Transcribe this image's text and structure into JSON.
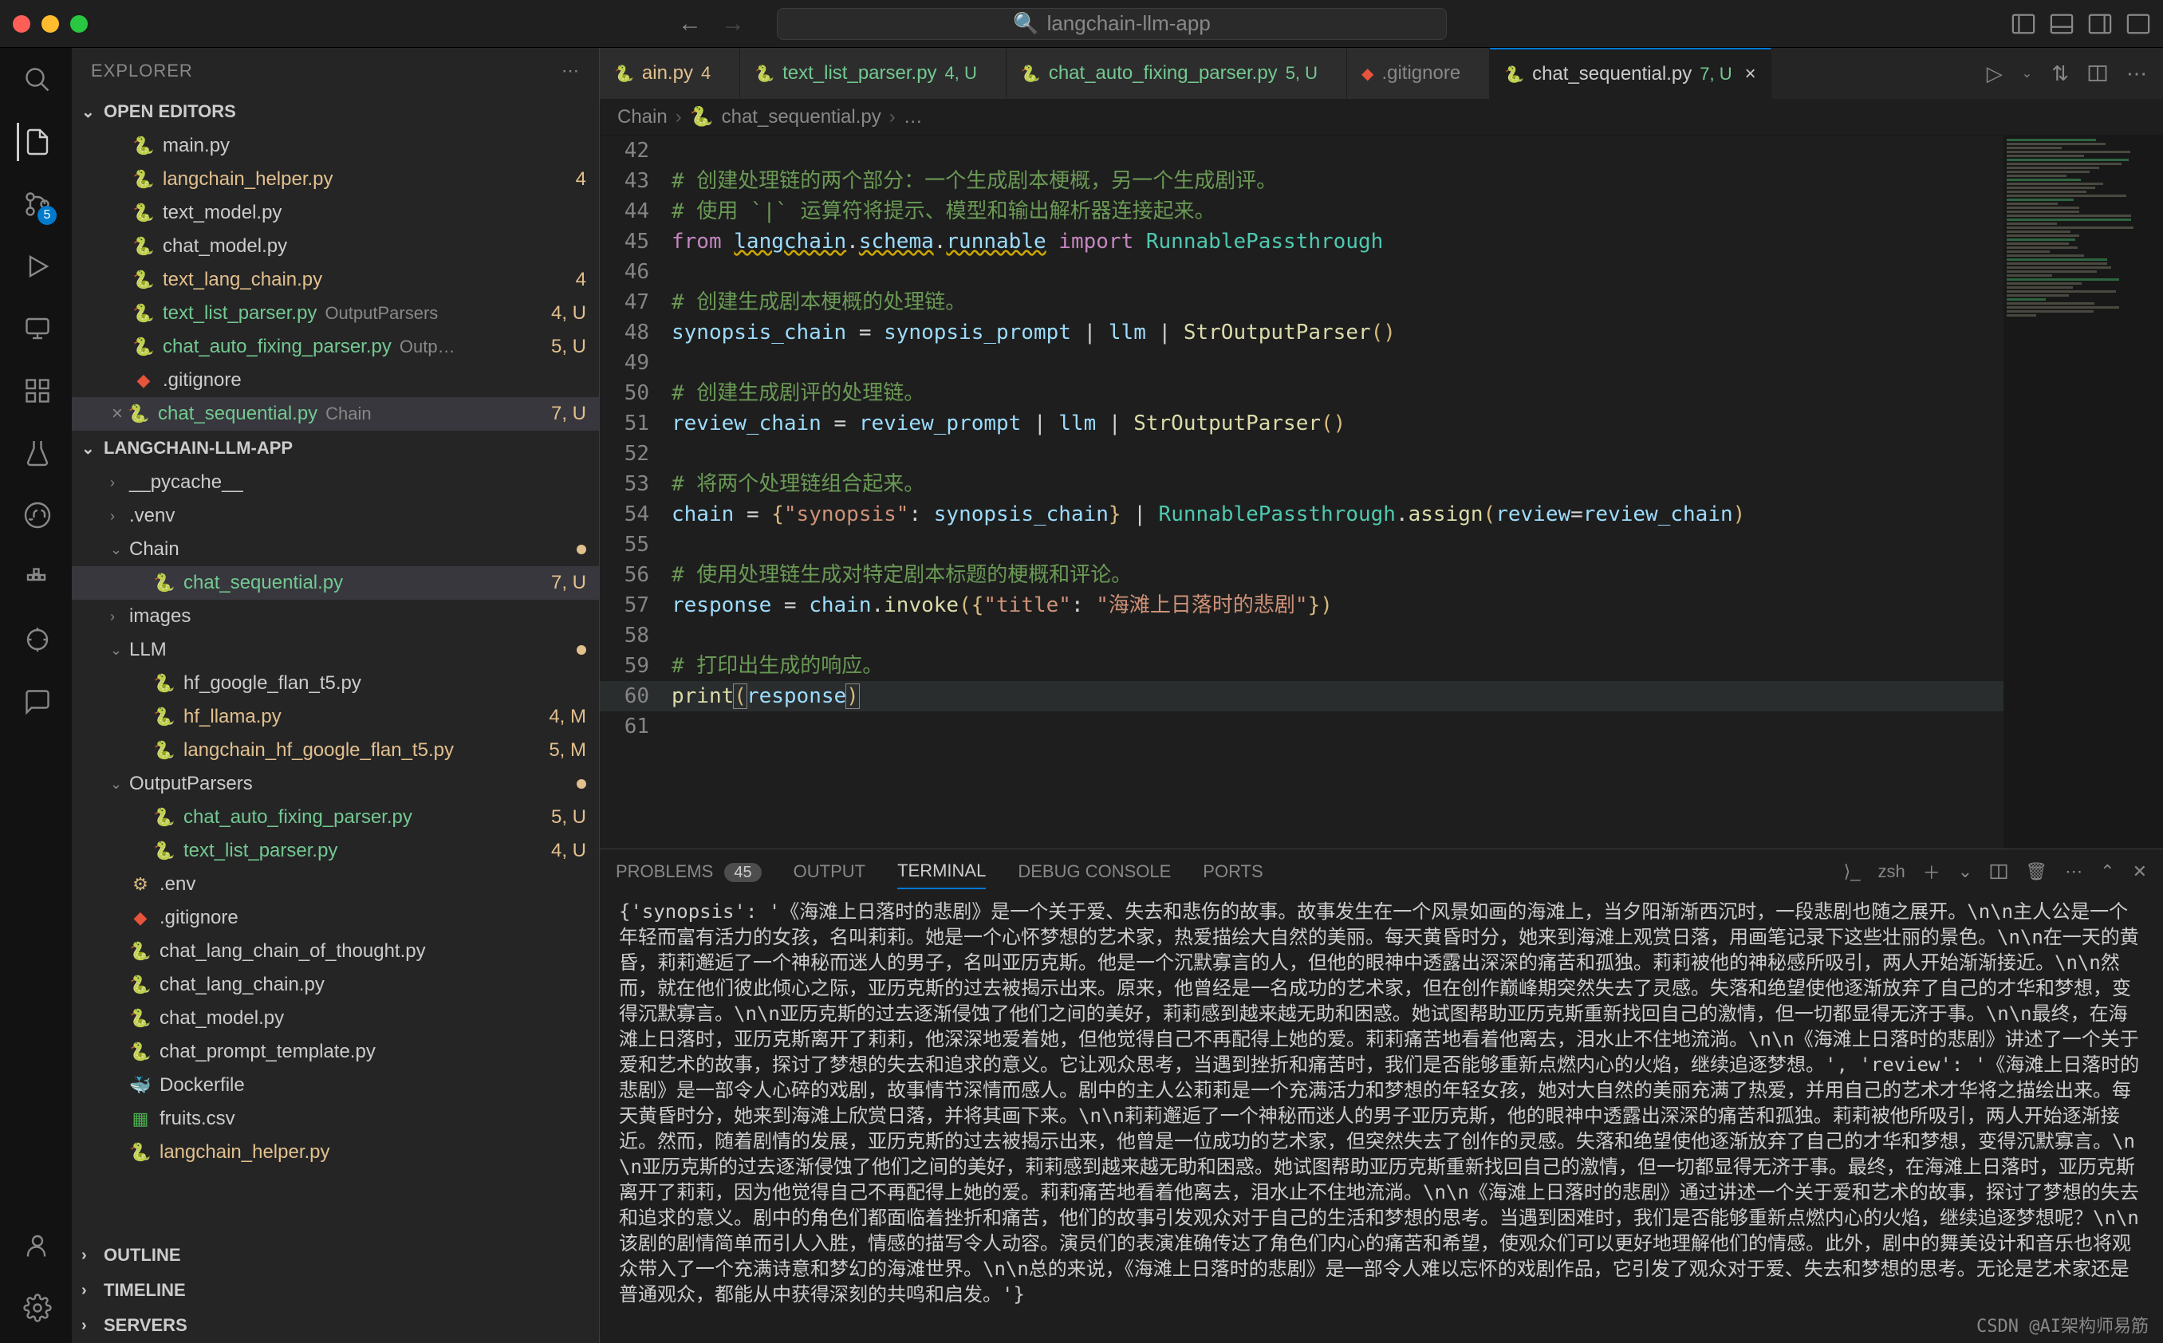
{
  "titlebar": {
    "search_placeholder": "langchain-llm-app",
    "search_icon": "🔍"
  },
  "activitybar": {
    "scm_badge": "5"
  },
  "sidebar": {
    "title": "EXPLORER",
    "open_editors_title": "OPEN EDITORS",
    "project_title": "LANGCHAIN-LLM-APP",
    "outline_title": "OUTLINE",
    "timeline_title": "TIMELINE",
    "servers_title": "SERVERS",
    "open_editors": [
      {
        "icon": "py",
        "label": "main.py",
        "desc": "",
        "tail": "",
        "cls": ""
      },
      {
        "icon": "py",
        "label": "langchain_helper.py",
        "desc": "",
        "tail": "4",
        "cls": "modified"
      },
      {
        "icon": "py",
        "label": "text_model.py",
        "desc": "",
        "tail": "",
        "cls": ""
      },
      {
        "icon": "py",
        "label": "chat_model.py",
        "desc": "",
        "tail": "",
        "cls": ""
      },
      {
        "icon": "py",
        "label": "text_lang_chain.py",
        "desc": "",
        "tail": "4",
        "cls": "modified"
      },
      {
        "icon": "py",
        "label": "text_list_parser.py",
        "desc": "OutputParsers",
        "tail": "4, U",
        "cls": "untracked"
      },
      {
        "icon": "py",
        "label": "chat_auto_fixing_parser.py",
        "desc": "Outp…",
        "tail": "5, U",
        "cls": "untracked"
      },
      {
        "icon": "git",
        "label": ".gitignore",
        "desc": "",
        "tail": "",
        "cls": ""
      },
      {
        "icon": "py",
        "label": "chat_sequential.py",
        "desc": "Chain",
        "tail": "7, U",
        "cls": "untracked",
        "active": true,
        "close": "×"
      }
    ],
    "tree": [
      {
        "depth": 0,
        "chev": "›",
        "icon": "",
        "label": "__pycache__",
        "cls": "",
        "section": true
      },
      {
        "depth": 0,
        "chev": "›",
        "icon": "",
        "label": ".venv",
        "cls": "",
        "section": true
      },
      {
        "depth": 0,
        "chev": "⌄",
        "icon": "",
        "label": "Chain",
        "cls": "",
        "section": true,
        "dot": true
      },
      {
        "depth": 1,
        "icon": "py",
        "label": "chat_sequential.py",
        "tail": "7, U",
        "cls": "untracked",
        "active": true
      },
      {
        "depth": 0,
        "chev": "›",
        "icon": "",
        "label": "images",
        "cls": "",
        "section": true
      },
      {
        "depth": 0,
        "chev": "⌄",
        "icon": "",
        "label": "LLM",
        "cls": "",
        "section": true,
        "dot": true
      },
      {
        "depth": 1,
        "icon": "py",
        "label": "hf_google_flan_t5.py"
      },
      {
        "depth": 1,
        "icon": "py",
        "label": "hf_llama.py",
        "tail": "4, M",
        "cls": "modified"
      },
      {
        "depth": 1,
        "icon": "py",
        "label": "langchain_hf_google_flan_t5.py",
        "tail": "5, M",
        "cls": "modified"
      },
      {
        "depth": 0,
        "chev": "⌄",
        "icon": "",
        "label": "OutputParsers",
        "cls": "",
        "section": true,
        "dot": true
      },
      {
        "depth": 1,
        "icon": "py",
        "label": "chat_auto_fixing_parser.py",
        "tail": "5, U",
        "cls": "untracked"
      },
      {
        "depth": 1,
        "icon": "py",
        "label": "text_list_parser.py",
        "tail": "4, U",
        "cls": "untracked"
      },
      {
        "depth": 0,
        "icon": "env",
        "label": ".env"
      },
      {
        "depth": 0,
        "icon": "git",
        "label": ".gitignore"
      },
      {
        "depth": 0,
        "icon": "py",
        "label": "chat_lang_chain_of_thought.py"
      },
      {
        "depth": 0,
        "icon": "py",
        "label": "chat_lang_chain.py"
      },
      {
        "depth": 0,
        "icon": "py",
        "label": "chat_model.py"
      },
      {
        "depth": 0,
        "icon": "py",
        "label": "chat_prompt_template.py"
      },
      {
        "depth": 0,
        "icon": "docker",
        "label": "Dockerfile"
      },
      {
        "depth": 0,
        "icon": "csv",
        "label": "fruits.csv"
      },
      {
        "depth": 0,
        "icon": "py",
        "label": "langchain_helper.py",
        "cls": "modified dimmed"
      }
    ]
  },
  "tabs": [
    {
      "icon": "py",
      "label": "ain.py",
      "status": "4",
      "cls": "modified"
    },
    {
      "icon": "py",
      "label": "text_list_parser.py",
      "status": "4, U",
      "cls": "untracked"
    },
    {
      "icon": "py",
      "label": "chat_auto_fixing_parser.py",
      "status": "5, U",
      "cls": "untracked"
    },
    {
      "icon": "git",
      "label": ".gitignore",
      "status": "",
      "cls": ""
    },
    {
      "icon": "py",
      "label": "chat_sequential.py",
      "status": "7, U",
      "cls": "untracked",
      "active": true,
      "close": "×"
    }
  ],
  "breadcrumb": [
    "Chain",
    "chat_sequential.py",
    "…"
  ],
  "code_start_line": 42,
  "code_lines": [
    {
      "t": ""
    },
    {
      "t": "# 创建处理链的两个部分：一个生成剧本梗概，另一个生成剧评。",
      "c": "comment"
    },
    {
      "t": "# 使用 `|` 运算符将提示、模型和输出解析器连接起来。",
      "c": "comment"
    },
    {
      "raw": true,
      "html": "<span class='c-kw'>from</span> <span class='c-var squiggle'>langchain</span><span class='c-op'>.</span><span class='c-var squiggle'>schema</span><span class='c-op'>.</span><span class='c-var squiggle'>runnable</span> <span class='c-kw'>import</span> <span class='c-type'>RunnablePassthrough</span>"
    },
    {
      "t": ""
    },
    {
      "t": "# 创建生成剧本梗概的处理链。",
      "c": "comment"
    },
    {
      "raw": true,
      "html": "<span class='c-var'>synopsis_chain</span> <span class='c-op'>=</span> <span class='c-var'>synopsis_prompt</span> <span class='c-op'>|</span> <span class='c-var'>llm</span> <span class='c-op'>|</span> <span class='c-func'>StrOutputParser</span><span class='c-punc'>()</span>"
    },
    {
      "t": ""
    },
    {
      "t": "# 创建生成剧评的处理链。",
      "c": "comment"
    },
    {
      "raw": true,
      "html": "<span class='c-var'>review_chain</span> <span class='c-op'>=</span> <span class='c-var'>review_prompt</span> <span class='c-op'>|</span> <span class='c-var'>llm</span> <span class='c-op'>|</span> <span class='c-func'>StrOutputParser</span><span class='c-punc'>()</span>"
    },
    {
      "t": ""
    },
    {
      "t": "# 将两个处理链组合起来。",
      "c": "comment"
    },
    {
      "raw": true,
      "html": "<span class='c-var'>chain</span> <span class='c-op'>=</span> <span class='c-punc'>{</span><span class='c-str'>\"synopsis\"</span><span class='c-op'>:</span> <span class='c-var'>synopsis_chain</span><span class='c-punc'>}</span> <span class='c-op'>|</span> <span class='c-type'>RunnablePassthrough</span><span class='c-op'>.</span><span class='c-func'>assign</span><span class='c-punc'>(</span><span class='c-var'>review</span><span class='c-op'>=</span><span class='c-var'>review_chain</span><span class='c-punc'>)</span>"
    },
    {
      "t": ""
    },
    {
      "t": "# 使用处理链生成对特定剧本标题的梗概和评论。",
      "c": "comment"
    },
    {
      "raw": true,
      "html": "<span class='c-var'>response</span> <span class='c-op'>=</span> <span class='c-var'>chain</span><span class='c-op'>.</span><span class='c-func'>invoke</span><span class='c-punc'>({</span><span class='c-str'>\"title\"</span><span class='c-op'>:</span> <span class='c-str'>\"海滩上日落时的悲剧\"</span><span class='c-punc'>})</span>"
    },
    {
      "t": ""
    },
    {
      "t": "# 打印出生成的响应。",
      "c": "comment"
    },
    {
      "raw": true,
      "cursor": true,
      "html": "<span class='c-func'>print</span><span class='c-punc cursor-brace'>(</span><span class='c-var'>response</span><span class='c-punc cursor-brace'>)</span>"
    },
    {
      "t": ""
    }
  ],
  "panel": {
    "tabs": {
      "problems": "PROBLEMS",
      "problems_count": "45",
      "output": "OUTPUT",
      "terminal": "TERMINAL",
      "debug": "DEBUG CONSOLE",
      "ports": "PORTS"
    },
    "shell_label": "zsh",
    "terminal_text": "{'synopsis': '《海滩上日落时的悲剧》是一个关于爱、失去和悲伤的故事。故事发生在一个风景如画的海滩上，当夕阳渐渐西沉时，一段悲剧也随之展开。\\n\\n主人公是一个年轻而富有活力的女孩，名叫莉莉。她是一个心怀梦想的艺术家，热爱描绘大自然的美丽。每天黄昏时分，她来到海滩上观赏日落，用画笔记录下这些壮丽的景色。\\n\\n在一天的黄昏，莉莉邂逅了一个神秘而迷人的男子，名叫亚历克斯。他是一个沉默寡言的人，但他的眼神中透露出深深的痛苦和孤独。莉莉被他的神秘感所吸引，两人开始渐渐接近。\\n\\n然而，就在他们彼此倾心之际，亚历克斯的过去被揭示出来。原来，他曾经是一名成功的艺术家，但在创作巅峰期突然失去了灵感。失落和绝望使他逐渐放弃了自己的才华和梦想，变得沉默寡言。\\n\\n亚历克斯的过去逐渐侵蚀了他们之间的美好，莉莉感到越来越无助和困惑。她试图帮助亚历克斯重新找回自己的激情，但一切都显得无济于事。\\n\\n最终，在海滩上日落时，亚历克斯离开了莉莉，他深深地爱着她，但他觉得自己不再配得上她的爱。莉莉痛苦地看着他离去，泪水止不住地流淌。\\n\\n《海滩上日落时的悲剧》讲述了一个关于爱和艺术的故事，探讨了梦想的失去和追求的意义。它让观众思考，当遇到挫折和痛苦时，我们是否能够重新点燃内心的火焰，继续追逐梦想。', 'review': '《海滩上日落时的悲剧》是一部令人心碎的戏剧，故事情节深情而感人。剧中的主人公莉莉是一个充满活力和梦想的年轻女孩，她对大自然的美丽充满了热爱，并用自己的艺术才华将之描绘出来。每天黄昏时分，她来到海滩上欣赏日落，并将其画下来。\\n\\n莉莉邂逅了一个神秘而迷人的男子亚历克斯，他的眼神中透露出深深的痛苦和孤独。莉莉被他所吸引，两人开始逐渐接近。然而，随着剧情的发展，亚历克斯的过去被揭示出来，他曾是一位成功的艺术家，但突然失去了创作的灵感。失落和绝望使他逐渐放弃了自己的才华和梦想，变得沉默寡言。\\n\\n亚历克斯的过去逐渐侵蚀了他们之间的美好，莉莉感到越来越无助和困惑。她试图帮助亚历克斯重新找回自己的激情，但一切都显得无济于事。最终，在海滩上日落时，亚历克斯离开了莉莉，因为他觉得自己不再配得上她的爱。莉莉痛苦地看着他离去，泪水止不住地流淌。\\n\\n《海滩上日落时的悲剧》通过讲述一个关于爱和艺术的故事，探讨了梦想的失去和追求的意义。剧中的角色们都面临着挫折和痛苦，他们的故事引发观众对于自己的生活和梦想的思考。当遇到困难时，我们是否能够重新点燃内心的火焰，继续追逐梦想呢？\\n\\n该剧的剧情简单而引人入胜，情感的描写令人动容。演员们的表演准确传达了角色们内心的痛苦和希望，使观众们可以更好地理解他们的情感。此外，剧中的舞美设计和音乐也将观众带入了一个充满诗意和梦幻的海滩世界。\\n\\n总的来说，《海滩上日落时的悲剧》是一部令人难以忘怀的戏剧作品，它引发了观众对于爱、失去和梦想的思考。无论是艺术家还是普通观众，都能从中获得深刻的共鸣和启发。'}"
  },
  "watermark": "CSDN @AI架构师易筋"
}
